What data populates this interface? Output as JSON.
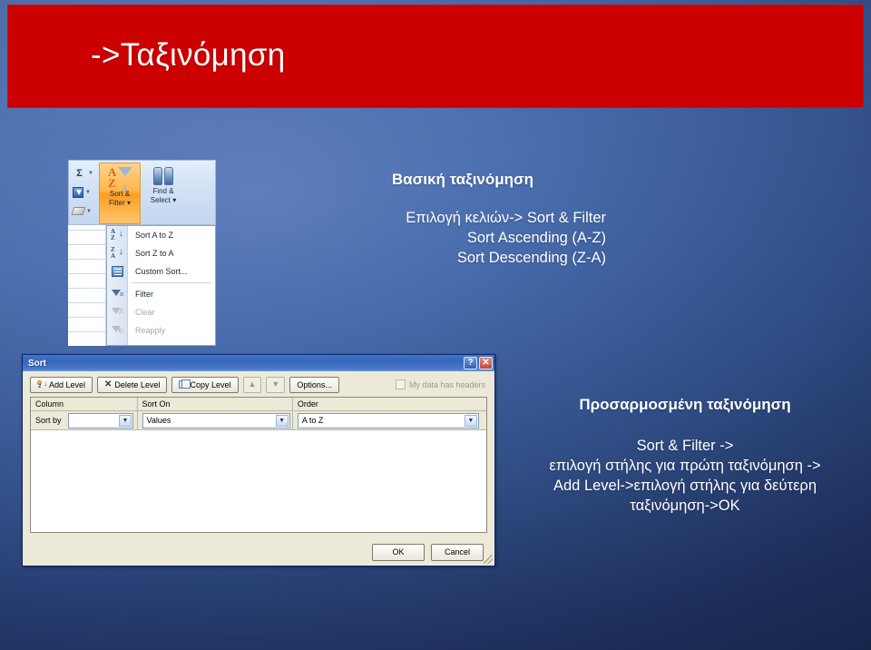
{
  "slide": {
    "title": "->Ταξινόμηση",
    "accent_red": "#cc0000",
    "background_blue": "#456aad"
  },
  "basic_sort_block": {
    "heading": "Βασική ταξινόμηση",
    "lines": [
      "Επιλογή κελιών-> Sort & Filter",
      "Sort Ascending (A-Z)",
      "Sort Descending (Z-A)"
    ]
  },
  "custom_sort_block": {
    "heading": "Προσαρμοσμένη ταξινόμηση",
    "lines": [
      "Sort & Filter ->",
      "επιλογή στήλης για πρώτη ταξινόμηση ->",
      "Add Level->επιλογή στήλης για δεύτερη",
      "ταξινόμηση->OK"
    ]
  },
  "ribbon_screenshot": {
    "small_buttons": [
      {
        "icon": "sum-icon",
        "glyph": "Σ"
      },
      {
        "icon": "fill-icon",
        "glyph": ""
      },
      {
        "icon": "clear-eraser-icon",
        "glyph": ""
      }
    ],
    "big_buttons": [
      {
        "label_line1": "Sort &",
        "label_line2": "Filter ▾",
        "icon": "sort-filter-icon",
        "active": true
      },
      {
        "label_line1": "Find &",
        "label_line2": "Select ▾",
        "icon": "find-select-icon",
        "active": false
      }
    ],
    "menu_items": [
      {
        "label": "Sort A to Z",
        "icon": "sort-a-to-z-icon",
        "enabled": true
      },
      {
        "label": "Sort Z to A",
        "icon": "sort-z-to-a-icon",
        "enabled": true
      },
      {
        "label": "Custom Sort...",
        "icon": "custom-sort-icon",
        "enabled": true
      },
      {
        "label": "Filter",
        "icon": "filter-icon",
        "enabled": true
      },
      {
        "label": "Clear",
        "icon": "clear-filter-icon",
        "enabled": false
      },
      {
        "label": "Reapply",
        "icon": "reapply-filter-icon",
        "enabled": false
      }
    ]
  },
  "sort_dialog": {
    "title": "Sort",
    "help_button": "?",
    "close_button": "✕",
    "toolbar": {
      "add_level": "Add Level",
      "delete_level": "Delete Level",
      "copy_level": "Copy Level",
      "move_up": "▲",
      "move_down": "▼",
      "options": "Options...",
      "headers_checkbox_label": "My data has headers",
      "headers_checked": false
    },
    "grid": {
      "headers": [
        "Column",
        "Sort On",
        "Order"
      ],
      "rows": [
        {
          "level_label": "Sort by",
          "column_value": "",
          "sort_on_value": "Values",
          "order_value": "A to Z"
        }
      ]
    },
    "footer": {
      "ok": "OK",
      "cancel": "Cancel"
    }
  }
}
